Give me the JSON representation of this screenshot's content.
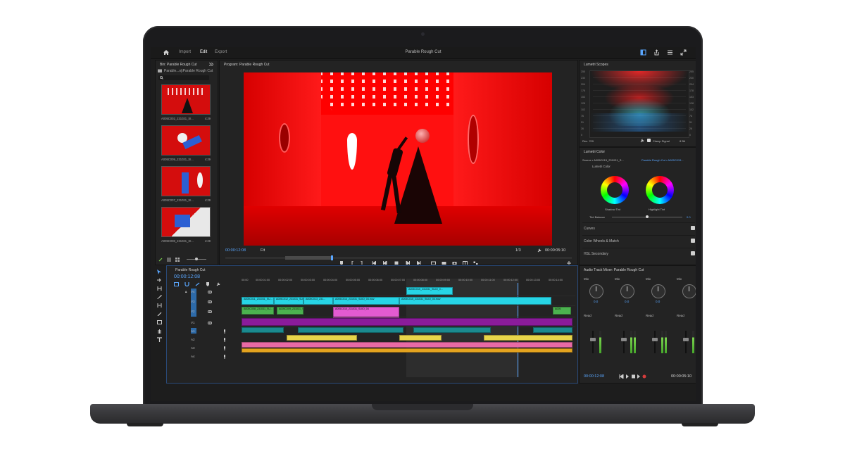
{
  "app": {
    "title": "Parable Rough Cut",
    "nav": [
      "Import",
      "Edit",
      "Export"
    ],
    "active_nav": "Edit"
  },
  "bin": {
    "title": "Bin: Parable Rough Cut",
    "path": "Parable...oj\\Parable Rough Cut",
    "clips": [
      {
        "name": "A005C002_231031_SI...",
        "duration": "4:29"
      },
      {
        "name": "A005C009_231031_SI...",
        "duration": "4:29"
      },
      {
        "name": "A005C007_231031_SI...",
        "duration": "4:29"
      },
      {
        "name": "A005C008_231031_SI...",
        "duration": "4:29"
      }
    ]
  },
  "program": {
    "title": "Program: Parable Rough Cut",
    "current_tc": "00:00:12:08",
    "fit": "Fit",
    "resolution": "1/3",
    "duration_tc": "00:00:05:10"
  },
  "timeline": {
    "title": "Parable Rough Cut",
    "current_tc": "00:00:12:08",
    "ruler": [
      "00:00",
      "00:00:01:00",
      "00:00:02:00",
      "00:00:03:00",
      "00:00:04:00",
      "00:00:05:00",
      "00:00:06:00",
      "00:00:07:00",
      "00:00:08:00",
      "00:00:09:00",
      "00:00:10:00",
      "00:00:11:00",
      "00:00:12:00",
      "00:00:13:00",
      "00:00:14:00"
    ],
    "video_tracks": [
      "V4",
      "V3",
      "V2",
      "V1"
    ],
    "audio_tracks": [
      "A1",
      "A2",
      "A3",
      "A4"
    ],
    "clips": {
      "v4": "A005C015_231031_SUIO_0...",
      "v3_a": "A005C011_231031_SU...",
      "v3_b": "A005C012_231031_SU...",
      "v3_c": "A005C013_231...",
      "v3_d": "A005C014_231031_SUIO_04.mov",
      "v3_e": "A005C015_231031_SUIO_04.mov",
      "v2_a": "A005C008_231031_SU...",
      "v2_b": "A005C009_231031_SUIO",
      "v2_c": "A005C010_231031_SUIO_04",
      "v2_d": "A005"
    }
  },
  "scopes": {
    "title": "Lumetri Scopes",
    "scale": [
      "255",
      "230",
      "204",
      "178",
      "153",
      "128",
      "102",
      "76",
      "51",
      "26",
      "0"
    ],
    "mode": "Rec. 709",
    "clamp_signal": "Clamp Signal",
    "bit_depth": "8 Bit"
  },
  "lumetri": {
    "title": "Lumetri Color",
    "source": "Source • A005C015_231031_S...",
    "sequence": "Parable Rough Cut • A005C015...",
    "effect": "Lumetri Color",
    "shadow_label": "Shadow Tint",
    "highlight_label": "Highlight Tint",
    "tint_balance_label": "Tint Balance",
    "tint_balance_value": "0.0",
    "sections": [
      "Curves",
      "Color Wheels & Match",
      "HSL Secondary"
    ]
  },
  "mixer": {
    "title": "Audio Track Mixer: Parable Rough Cut",
    "channel_mode": "Mix",
    "pan_value": "0.0",
    "automation": "Read",
    "current_tc": "00:00:12:08",
    "duration_tc": "00:00:05:10"
  },
  "colors": {
    "accent": "#5aa7ff",
    "video_red": "#ff0000",
    "clip_cyan": "#27d5e6",
    "clip_green": "#4bb24f",
    "clip_pink": "#e35bd1",
    "clip_purple": "#8a1c9a",
    "clip_teal": "#1b8a8f",
    "clip_yellow": "#e8d54a",
    "clip_orange": "#e3a31f"
  }
}
